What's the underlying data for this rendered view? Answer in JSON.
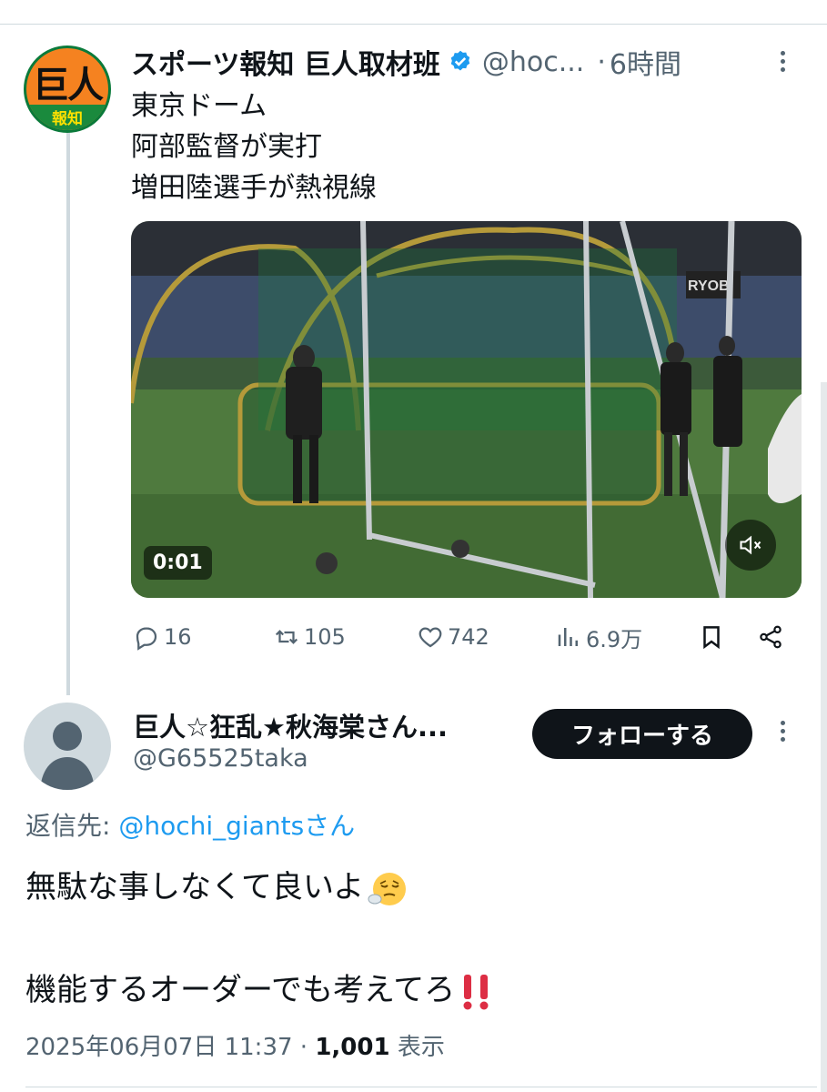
{
  "tweet": {
    "author_name": "スポーツ報知 巨人取材班",
    "handle": "@hoc...",
    "separator": "·",
    "time": "6時間",
    "avatar_text_main": "巨人",
    "avatar_text_sub": "報知",
    "body_lines": [
      "東京ドーム",
      "阿部監督が実打",
      "増田陸選手が熱視線"
    ],
    "video": {
      "timecode": "0:01",
      "sign_text": "RYOBI"
    },
    "stats": {
      "replies": "16",
      "retweets": "105",
      "likes": "742",
      "views": "6.9万"
    }
  },
  "reply": {
    "author_name": "巨人☆狂乱★秋海棠さん...",
    "handle": "@G65525taka",
    "follow_label": "フォローする",
    "reply_to_prefix": "返信先: ",
    "reply_to_handle": "@hochi_giants",
    "reply_to_suffix": "さん",
    "line1": "無駄な事しなくて良いよ",
    "line2": "機能するオーダーでも考えてろ",
    "date": "2025年06月07日 11:37",
    "separator": " · ",
    "view_count": "1,001",
    "view_label": " 表示"
  },
  "colors": {
    "text": "#0f1419",
    "secondary": "#536471",
    "link": "#1d9bf0",
    "verified": "#1d9bf0",
    "follow_button": "#0f1419"
  },
  "icons": [
    "verified-badge-icon",
    "more-icon",
    "reply-icon",
    "retweet-icon",
    "like-icon",
    "views-icon",
    "bookmark-icon",
    "share-icon",
    "mute-icon",
    "default-avatar-icon",
    "exhaling-face-icon",
    "double-exclamation-icon"
  ]
}
